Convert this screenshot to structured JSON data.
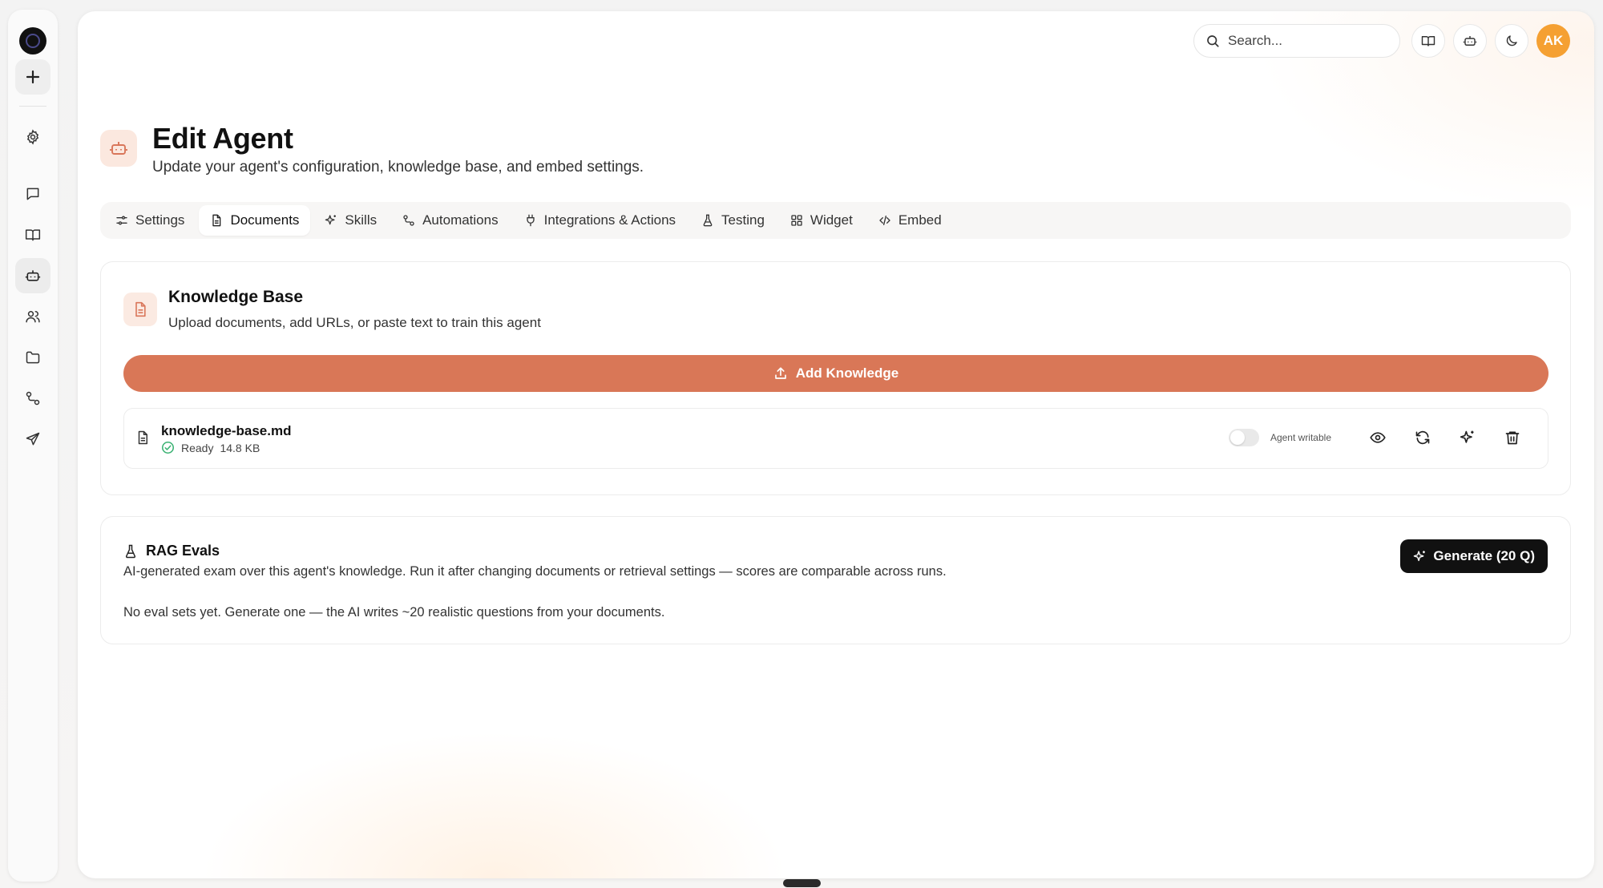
{
  "sidebar": {
    "logo_icon": "logo-icon",
    "new_icon": "plus-icon",
    "items": [
      {
        "id": "settings",
        "icon": "gear-icon"
      },
      {
        "id": "chat",
        "icon": "chat-bubble-icon"
      },
      {
        "id": "library",
        "icon": "book-icon"
      },
      {
        "id": "agents",
        "icon": "robot-icon",
        "active": true
      },
      {
        "id": "users",
        "icon": "users-icon"
      },
      {
        "id": "files",
        "icon": "folder-icon"
      },
      {
        "id": "workflows",
        "icon": "workflow-icon"
      },
      {
        "id": "send",
        "icon": "send-icon"
      }
    ]
  },
  "topbar": {
    "search_placeholder": "Search...",
    "avatar_initials": "AK",
    "avatar_color": "#F5A032"
  },
  "header": {
    "title": "Edit Agent",
    "subtitle": "Update your agent's configuration, knowledge base, and embed settings."
  },
  "tabs": [
    {
      "label": "Settings",
      "icon": "sliders-icon"
    },
    {
      "label": "Documents",
      "icon": "document-icon",
      "active": true
    },
    {
      "label": "Skills",
      "icon": "sparkle-icon"
    },
    {
      "label": "Automations",
      "icon": "workflow-icon"
    },
    {
      "label": "Integrations & Actions",
      "icon": "plug-icon"
    },
    {
      "label": "Testing",
      "icon": "flask-icon"
    },
    {
      "label": "Widget",
      "icon": "grid-icon"
    },
    {
      "label": "Embed",
      "icon": "code-icon"
    }
  ],
  "knowledge_base": {
    "title": "Knowledge Base",
    "description": "Upload documents, add URLs, or paste text to train this agent",
    "add_button_label": "Add Knowledge",
    "accent_color": "#D97757",
    "documents": [
      {
        "name": "knowledge-base.md",
        "status": "Ready",
        "size": "14.8 KB",
        "agent_writable_label": "Agent writable",
        "agent_writable": false
      }
    ]
  },
  "rag_evals": {
    "title": "RAG Evals",
    "description": "AI-generated exam over this agent's knowledge. Run it after changing documents or retrieval settings — scores are comparable across runs.",
    "empty_text": "No eval sets yet. Generate one — the AI writes ~20 realistic questions from your documents.",
    "generate_button_label": "Generate (20 Q)"
  }
}
